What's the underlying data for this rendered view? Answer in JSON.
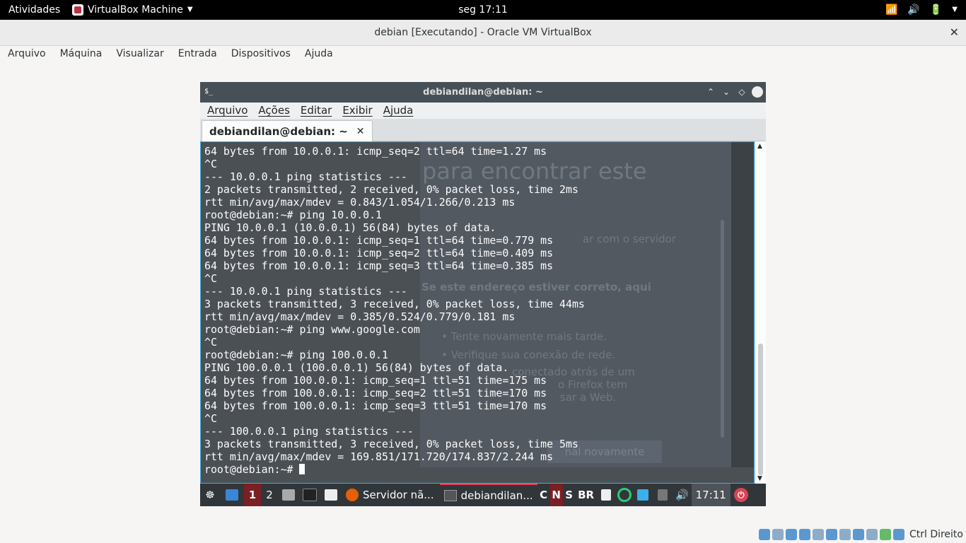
{
  "topbar": {
    "activities": "Atividades",
    "app_name": "VirtualBox Machine",
    "clock": "seg 17:11"
  },
  "vbox": {
    "window_title": "debian [Executando] - Oracle VM VirtualBox",
    "menu": [
      "Arquivo",
      "Máquina",
      "Visualizar",
      "Entrada",
      "Dispositivos",
      "Ajuda"
    ],
    "host_key": "Ctrl Direito"
  },
  "konsole": {
    "title": "debiandilan@debian: ~",
    "menu": [
      "Arquivo",
      "Ações",
      "Editar",
      "Exibir",
      "Ajuda"
    ],
    "tab_label": "debiandilan@debian: ~",
    "lines": [
      "64 bytes from 10.0.0.1: icmp_seq=2 ttl=64 time=1.27 ms",
      "^C",
      "--- 10.0.0.1 ping statistics ---",
      "2 packets transmitted, 2 received, 0% packet loss, time 2ms",
      "rtt min/avg/max/mdev = 0.843/1.054/1.266/0.213 ms",
      "root@debian:~# ping 10.0.0.1",
      "PING 10.0.0.1 (10.0.0.1) 56(84) bytes of data.",
      "64 bytes from 10.0.0.1: icmp_seq=1 ttl=64 time=0.779 ms",
      "64 bytes from 10.0.0.1: icmp_seq=2 ttl=64 time=0.409 ms",
      "64 bytes from 10.0.0.1: icmp_seq=3 ttl=64 time=0.385 ms",
      "^C",
      "--- 10.0.0.1 ping statistics ---",
      "3 packets transmitted, 3 received, 0% packet loss, time 44ms",
      "rtt min/avg/max/mdev = 0.385/0.524/0.779/0.181 ms",
      "root@debian:~# ping www.google.com",
      "^C",
      "root@debian:~# ping 100.0.0.1",
      "PING 100.0.0.1 (100.0.0.1) 56(84) bytes of data.",
      "64 bytes from 100.0.0.1: icmp_seq=1 ttl=51 time=175 ms",
      "64 bytes from 100.0.0.1: icmp_seq=2 ttl=51 time=170 ms",
      "64 bytes from 100.0.0.1: icmp_seq=3 ttl=51 time=170 ms",
      "^C",
      "--- 100.0.0.1 ping statistics ---",
      "3 packets transmitted, 3 received, 0% packet loss, time 5ms",
      "rtt min/avg/max/mdev = 169.851/171.720/174.837/2.244 ms"
    ],
    "prompt": "root@debian:~# ",
    "background_page": {
      "heading": "para encontrar este",
      "line1": "ar com o servidor",
      "bold": "Se este endereço estiver correto, aqui",
      "item1": "• Tente novamente mais tarde.",
      "item2": "• Verifique sua conexão de rede.",
      "item3": "conectado atrás de um",
      "item4": "o Firefox tem",
      "item5": "sar a Web.",
      "button": "nal novamente"
    }
  },
  "guest_panel": {
    "desktop1": "1",
    "desktop2": "2",
    "firefox_task": "Servidor nã...",
    "konsole_task": "debiandilan...",
    "indicators": [
      "C",
      "N",
      "S",
      "BR"
    ],
    "clock": "17:11"
  },
  "colors": {
    "terminal_bg": "#4b5055",
    "konsole_titlebar": "#475057",
    "accent_red": "#da4453",
    "focus_blue": "#3daee9"
  }
}
